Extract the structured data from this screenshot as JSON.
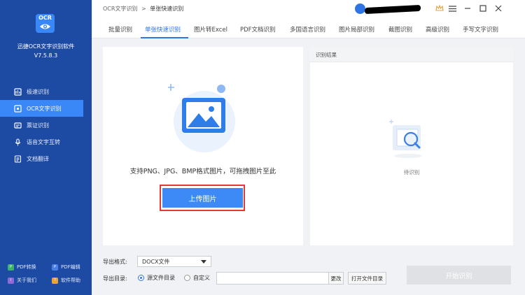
{
  "app": {
    "logo_text": "OCR",
    "name": "迅捷OCR文字识别软件",
    "version": "V7.5.8.3"
  },
  "sidebar": {
    "items": [
      {
        "label": "极速识别",
        "icon": "speed-recognize-icon",
        "active": false
      },
      {
        "label": "OCR文字识别",
        "icon": "ocr-doc-icon",
        "active": true
      },
      {
        "label": "票证识别",
        "icon": "ticket-icon",
        "active": false
      },
      {
        "label": "语音文字互转",
        "icon": "microphone-icon",
        "active": false
      },
      {
        "label": "文档翻译",
        "icon": "translate-icon",
        "active": false
      }
    ],
    "links": {
      "pdf_convert": "PDF转换",
      "pdf_edit": "PDF编辑",
      "about": "关于我们",
      "help": "软件帮助"
    }
  },
  "header": {
    "breadcrumb_root": "OCR文字识别",
    "breadcrumb_sep": ">",
    "breadcrumb_current": "单张快速识别"
  },
  "tabs": [
    {
      "label": "批量识别"
    },
    {
      "label": "单张快速识别"
    },
    {
      "label": "图片转Excel"
    },
    {
      "label": "PDF文档识别"
    },
    {
      "label": "多国语言识别"
    },
    {
      "label": "图片局部识别"
    },
    {
      "label": "截图识别"
    },
    {
      "label": "高级识别"
    },
    {
      "label": "手写文字识别"
    }
  ],
  "upload": {
    "hint": "支持PNG、JPG、BMP格式图片，可拖拽图片至此",
    "button_label": "上传图片"
  },
  "result": {
    "title": "识别结果",
    "status": "待识别"
  },
  "export": {
    "format_label": "导出格式:",
    "format_value": "DOCX文件",
    "dir_label": "导出目录:",
    "radio_source": "源文件目录",
    "radio_custom": "自定义",
    "path_value": "",
    "change_btn": "更改",
    "open_folder_btn": "打开文件目录",
    "start_btn": "开始识别"
  },
  "colors": {
    "sidebar_bg": "#1d4aa3",
    "accent": "#3d8af7",
    "highlight": "#e53935"
  }
}
